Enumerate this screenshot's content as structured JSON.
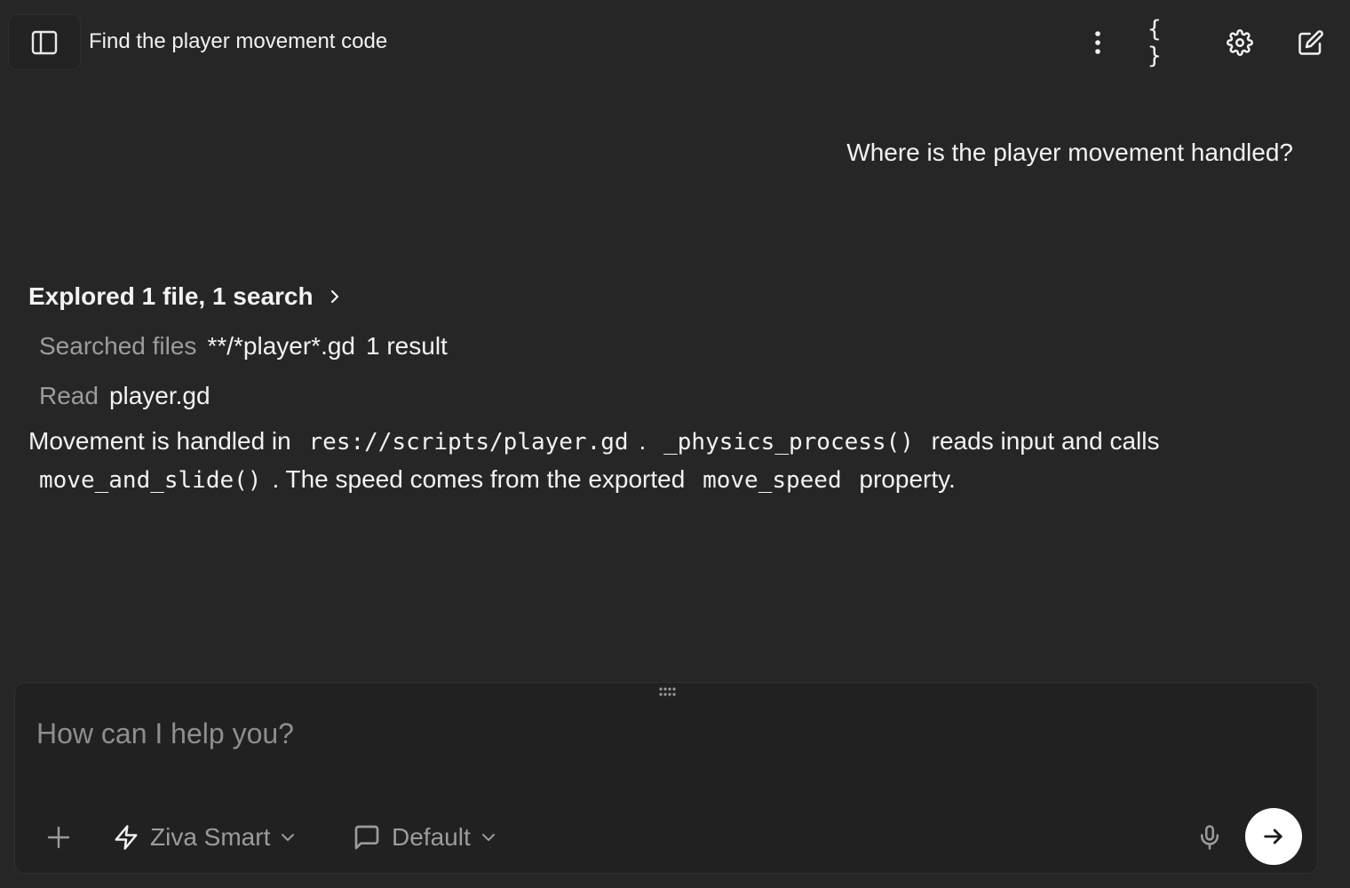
{
  "header": {
    "title": "Find the player movement code",
    "icons": [
      "sidebar-toggle-icon",
      "more-vertical-icon",
      "braces-icon",
      "gear-icon",
      "edit-icon"
    ],
    "braces_glyph": "{ }"
  },
  "conversation": {
    "user_message": "Where is the player movement handled?",
    "explored": {
      "label": "Explored 1 file, 1 search",
      "steps": [
        {
          "action": "Searched files",
          "target": "**/*player*.gd",
          "detail": "1 result"
        },
        {
          "action": "Read",
          "target": "player.gd",
          "detail": ""
        }
      ]
    },
    "answer": {
      "part1": "Movement is handled in",
      "code1": "res://scripts/player.gd",
      "part2": ".",
      "code2": "_physics_process()",
      "part3": "reads input and calls",
      "code3": "move_and_slide()",
      "part4": ". The speed comes from the exported",
      "code4": "move_speed",
      "part5": "property."
    }
  },
  "composer": {
    "placeholder": "How can I help you?",
    "value": "",
    "model": "Ziva Smart",
    "mode": "Default"
  },
  "colors": {
    "background": "#262626",
    "composer_background": "#212121",
    "text": "#f2f2f2",
    "muted_text": "#9c9c9c",
    "send_button": "#ffffff"
  }
}
